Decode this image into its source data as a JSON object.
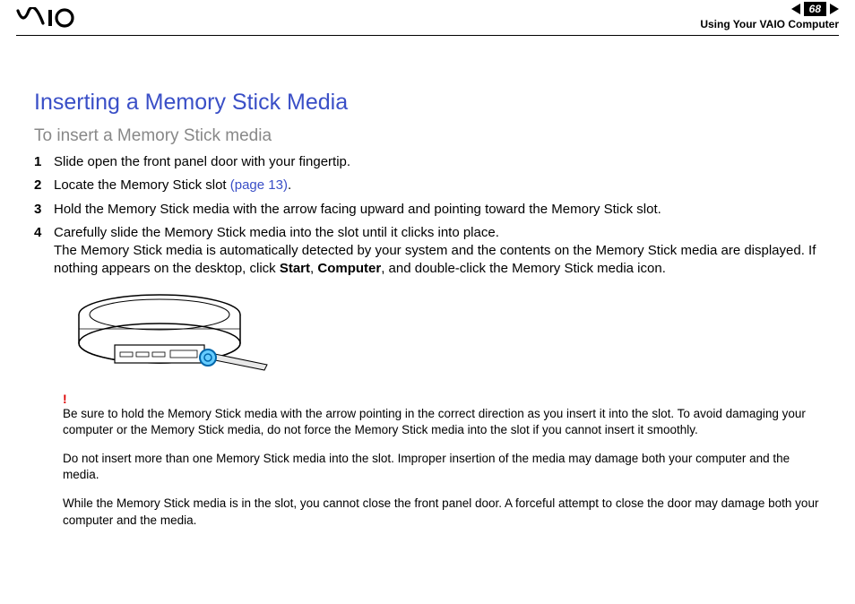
{
  "header": {
    "logo_text": "VAIO",
    "page_number": "68",
    "breadcrumb": "Using Your VAIO Computer"
  },
  "title": "Inserting a Memory Stick Media",
  "subtitle": "To insert a Memory Stick media",
  "steps": [
    {
      "num": "1",
      "text": "Slide open the front panel door with your fingertip."
    },
    {
      "num": "2",
      "text_before": "Locate the Memory Stick slot ",
      "link": "(page 13)",
      "text_after": "."
    },
    {
      "num": "3",
      "text": "Hold the Memory Stick media with the arrow facing upward and pointing toward the Memory Stick slot."
    },
    {
      "num": "4",
      "line1": "Carefully slide the Memory Stick media into the slot until it clicks into place.",
      "line2_a": "The Memory Stick media is automatically detected by your system and the contents on the Memory Stick media are displayed. If nothing appears on the desktop, click ",
      "bold1": "Start",
      "sep1": ", ",
      "bold2": "Computer",
      "line2_b": ", and double-click the Memory Stick media icon."
    }
  ],
  "warning_mark": "!",
  "notes": [
    "Be sure to hold the Memory Stick media with the arrow pointing in the correct direction as you insert it into the slot. To avoid damaging your computer or the Memory Stick media, do not force the Memory Stick media into the slot if you cannot insert it smoothly.",
    "Do not insert more than one Memory Stick media into the slot. Improper insertion of the media may damage both your computer and the media.",
    "While the Memory Stick media is in the slot, you cannot close the front panel door. A forceful attempt to close the door may damage both your computer and the media."
  ]
}
